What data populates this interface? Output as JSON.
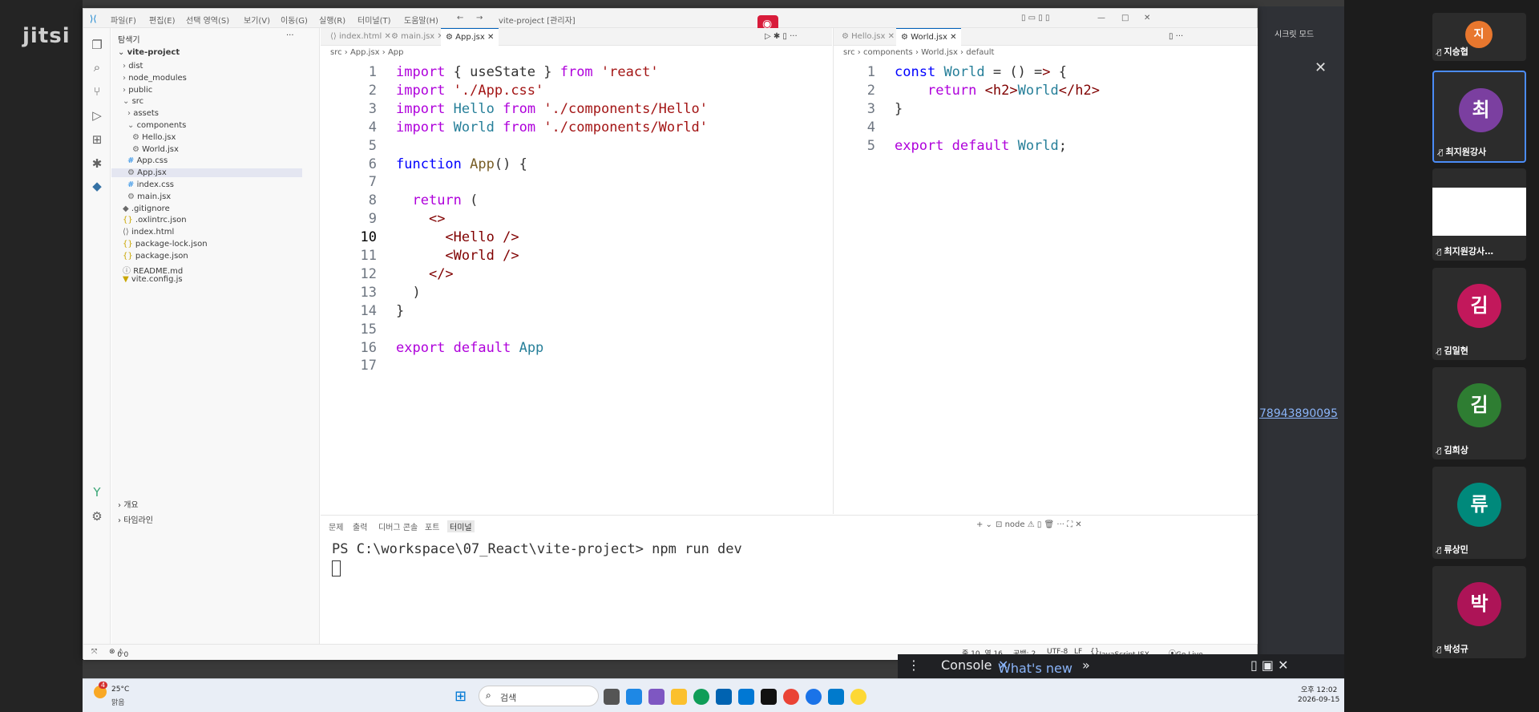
{
  "meeting": {
    "logo": "jitsi",
    "participants": [
      {
        "initial": "지",
        "name": "지승협",
        "color": "#e8772e"
      },
      {
        "initial": "최",
        "name": "최지원강사",
        "color": "#7b3fa0"
      },
      {
        "initial": "",
        "name": "최지원강사…",
        "color": "#ffffff"
      },
      {
        "initial": "김",
        "name": "김일현",
        "color": "#c2185b"
      },
      {
        "initial": "김",
        "name": "김희상",
        "color": "#2e7d32"
      },
      {
        "initial": "류",
        "name": "류상민",
        "color": "#00897b"
      },
      {
        "initial": "박",
        "name": "박성규",
        "color": "#ad1457"
      }
    ],
    "side_link": "78943890095",
    "theater_label": "시크릿 모드"
  },
  "vscode": {
    "menu": [
      "파일(F)",
      "편집(E)",
      "선택 영역(S)",
      "보기(V)",
      "이동(G)",
      "실행(R)",
      "터미널(T)",
      "도움말(H)"
    ],
    "window_title": "vite-project [관리자]",
    "explorer_title": "탐색기",
    "project": "vite-project",
    "tree": [
      {
        "label": "dist",
        "kind": "folder"
      },
      {
        "label": "node_modules",
        "kind": "folder"
      },
      {
        "label": "public",
        "kind": "folder"
      },
      {
        "label": "src",
        "kind": "folder-open"
      },
      {
        "label": "assets",
        "kind": "folder"
      },
      {
        "label": "components",
        "kind": "folder-open"
      },
      {
        "label": "Hello.jsx",
        "kind": "jsx"
      },
      {
        "label": "World.jsx",
        "kind": "jsx"
      },
      {
        "label": "App.css",
        "kind": "css"
      },
      {
        "label": "App.jsx",
        "kind": "jsx"
      },
      {
        "label": "index.css",
        "kind": "css"
      },
      {
        "label": "main.jsx",
        "kind": "jsx"
      },
      {
        "label": ".gitignore",
        "kind": "git"
      },
      {
        "label": ".oxlintrc.json",
        "kind": "json"
      },
      {
        "label": "index.html",
        "kind": "html"
      },
      {
        "label": "package-lock.json",
        "kind": "json"
      },
      {
        "label": "package.json",
        "kind": "json"
      },
      {
        "label": "README.md",
        "kind": "md"
      },
      {
        "label": "vite.config.js",
        "kind": "js"
      }
    ],
    "outline": "개요",
    "timeline": "타임라인",
    "left_tabs": [
      "index.html",
      "main.jsx",
      "App.jsx"
    ],
    "right_tabs": [
      "Hello.jsx",
      "World.jsx"
    ],
    "left_crumb": [
      "src",
      "App.jsx",
      "App"
    ],
    "right_crumb": [
      "src",
      "components",
      "World.jsx",
      "default"
    ],
    "left_code": [
      "import { useState } from 'react'",
      "import './App.css'",
      "import Hello from './components/Hello'",
      "import World from './components/World'",
      "",
      "function App() {",
      "",
      "  return (",
      "    <>",
      "      <Hello />",
      "      <World />",
      "    </>",
      "  )",
      "}",
      "",
      "export default App",
      ""
    ],
    "right_code": [
      "const World = () => {",
      "    return <h2>World</h2>",
      "}",
      "",
      "export default World;"
    ],
    "panel_tabs": [
      "문제",
      "출력",
      "디버그 콘솔",
      "포트",
      "터미널"
    ],
    "panel_shell": "node",
    "terminal_line": "PS C:\\workspace\\07_React\\vite-project> npm run dev",
    "status": {
      "errors": "0",
      "warnings": "0",
      "position": "줄 10, 열 16",
      "spaces": "공백: 2",
      "encoding": "UTF-8",
      "eol": "LF",
      "language": "JavaScript JSX",
      "golive": "Go Live"
    }
  },
  "devtools": {
    "console": "Console",
    "whats_new": "What's new"
  },
  "taskbar": {
    "temp": "25°C",
    "weather": "맑음",
    "weather_badge": "4",
    "search": "검색",
    "time": "오후 12:02",
    "date": "2026-09-15"
  }
}
